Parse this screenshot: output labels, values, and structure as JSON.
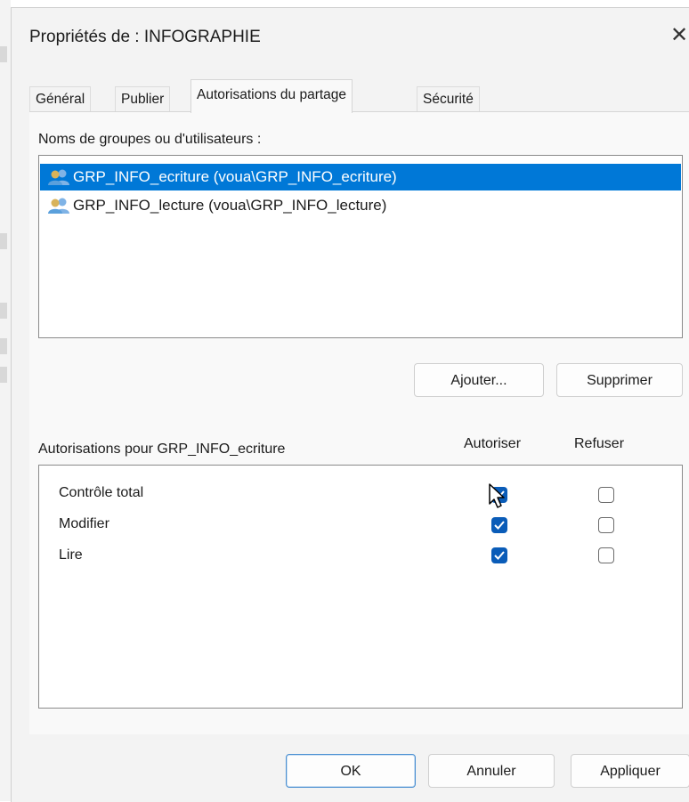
{
  "window": {
    "title": "Propriétés de : INFOGRAPHIE",
    "close_glyph": "✕"
  },
  "tabs": [
    {
      "label": "Général",
      "active": false
    },
    {
      "label": "Publier",
      "active": false
    },
    {
      "label": "Autorisations du partage",
      "active": true
    },
    {
      "label": "Sécurité",
      "active": false
    }
  ],
  "groups": {
    "label": "Noms de groupes ou d'utilisateurs :",
    "items": [
      {
        "label": "GRP_INFO_ecriture (voua\\GRP_INFO_ecriture)",
        "icon": "users-group-icon",
        "selected": true
      },
      {
        "label": "GRP_INFO_lecture (voua\\GRP_INFO_lecture)",
        "icon": "users-group-icon",
        "selected": false
      }
    ],
    "add_label": "Ajouter...",
    "remove_label": "Supprimer"
  },
  "permissions": {
    "label": "Autorisations pour GRP_INFO_ecriture",
    "allow_header": "Autoriser",
    "deny_header": "Refuser",
    "rows": [
      {
        "name": "Contrôle total",
        "allow": true,
        "deny": false
      },
      {
        "name": "Modifier",
        "allow": true,
        "deny": false
      },
      {
        "name": "Lire",
        "allow": true,
        "deny": false
      }
    ]
  },
  "footer": {
    "ok_label": "OK",
    "cancel_label": "Annuler",
    "apply_label": "Appliquer"
  },
  "colors": {
    "selection": "#0078d7",
    "checkbox_on": "#0a5cb8"
  }
}
